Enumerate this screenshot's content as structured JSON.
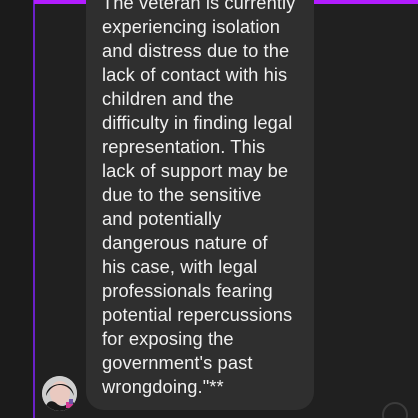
{
  "chat": {
    "message": {
      "lines": [
        "The veteran is currently",
        "experiencing isolation",
        "and distress due to the",
        "lack of contact with his",
        "children and the",
        "difficulty in finding legal",
        "representation. This",
        "lack of support may be",
        "due to the sensitive",
        "and potentially",
        "dangerous nature of",
        "his case, with legal",
        "professionals fearing",
        "potential repercussions",
        "for exposing the",
        "government's past",
        "wrongdoing.\"**"
      ]
    },
    "avatar_icon": "user-avatar-icon"
  },
  "colors": {
    "background": "#202020",
    "bubble": "#2f2f2f",
    "text": "#f0f0f0",
    "accent_bar": "#b21cff",
    "accent_line": "#6a21c8"
  }
}
